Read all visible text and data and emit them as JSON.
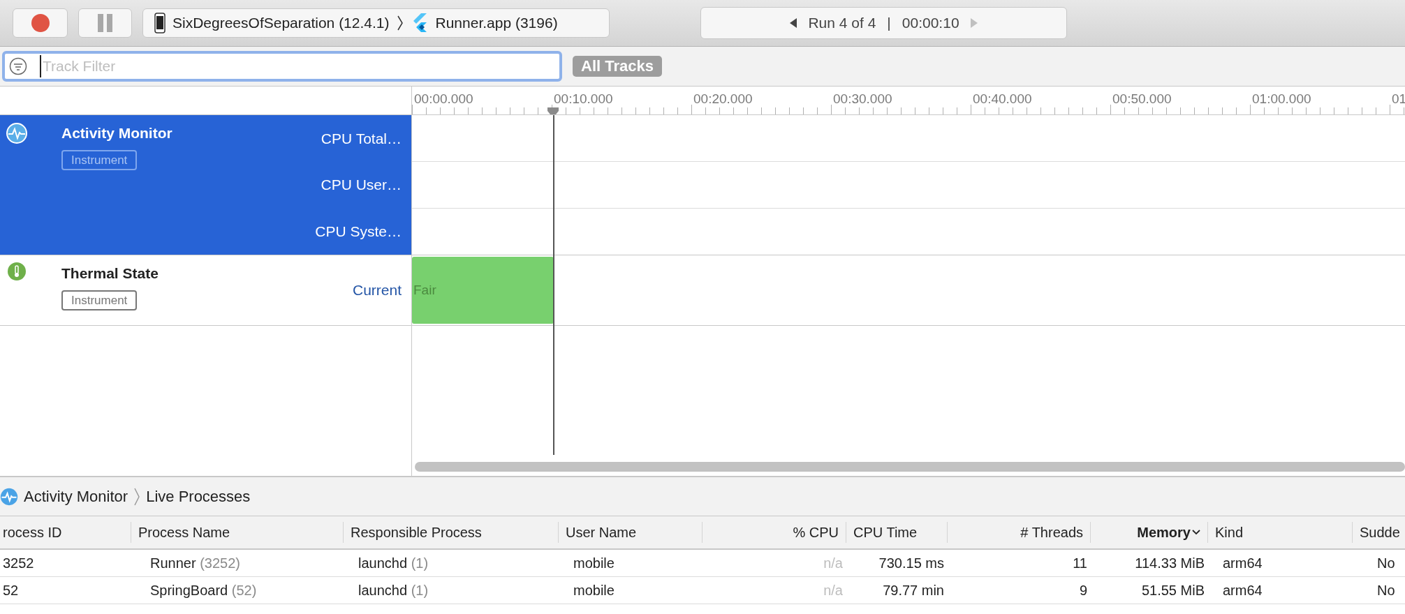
{
  "toolbar": {
    "target_device": "SixDegreesOfSeparation (12.4.1)",
    "target_app": "Runner.app (3196)",
    "run": {
      "label": "Run 4 of 4",
      "separator": "|",
      "time": "00:00:10",
      "prev_disabled": false,
      "next_disabled": true
    }
  },
  "filter": {
    "placeholder": "Track Filter",
    "scope_button": "All Tracks"
  },
  "ruler": {
    "ticks": [
      "00:00.000",
      "00:10.000",
      "00:20.000",
      "00:30.000",
      "00:40.000",
      "00:50.000",
      "01:00.000",
      "01"
    ]
  },
  "tracks": [
    {
      "kind": "activity",
      "title": "Activity Monitor",
      "badge": "Instrument",
      "selected": true,
      "lanes": [
        "CPU Total…",
        "CPU User…",
        "CPU Syste…"
      ]
    },
    {
      "kind": "thermal",
      "title": "Thermal State",
      "badge": "Instrument",
      "selected": false,
      "lanes": [
        "Current"
      ],
      "segment": "Fair"
    }
  ],
  "detail": {
    "breadcrumb": [
      "Activity Monitor",
      "Live Processes"
    ],
    "columns": [
      {
        "label": "rocess ID",
        "sorted": false
      },
      {
        "label": "Process Name",
        "sorted": false
      },
      {
        "label": "Responsible Process",
        "sorted": false
      },
      {
        "label": "User Name",
        "sorted": false
      },
      {
        "label": "% CPU",
        "sorted": false
      },
      {
        "label": "CPU Time",
        "sorted": false
      },
      {
        "label": "# Threads",
        "sorted": false
      },
      {
        "label": "Memory",
        "sorted": true
      },
      {
        "label": "Kind",
        "sorted": false
      },
      {
        "label": "Sudde",
        "sorted": false
      }
    ],
    "rows": [
      {
        "pid": "3252",
        "name": "Runner",
        "name_pid": "(3252)",
        "responsible": "launchd",
        "responsible_pid": "(1)",
        "user": "mobile",
        "cpu": "n/a",
        "cpu_time": "730.15 ms",
        "threads": "11",
        "memory": "114.33 MiB",
        "kind": "arm64",
        "sudden": "No"
      },
      {
        "pid": "52",
        "name": "SpringBoard",
        "name_pid": "(52)",
        "responsible": "launchd",
        "responsible_pid": "(1)",
        "user": "mobile",
        "cpu": "n/a",
        "cpu_time": "79.77 min",
        "threads": "9",
        "memory": "51.55 MiB",
        "kind": "arm64",
        "sudden": "No"
      }
    ]
  }
}
